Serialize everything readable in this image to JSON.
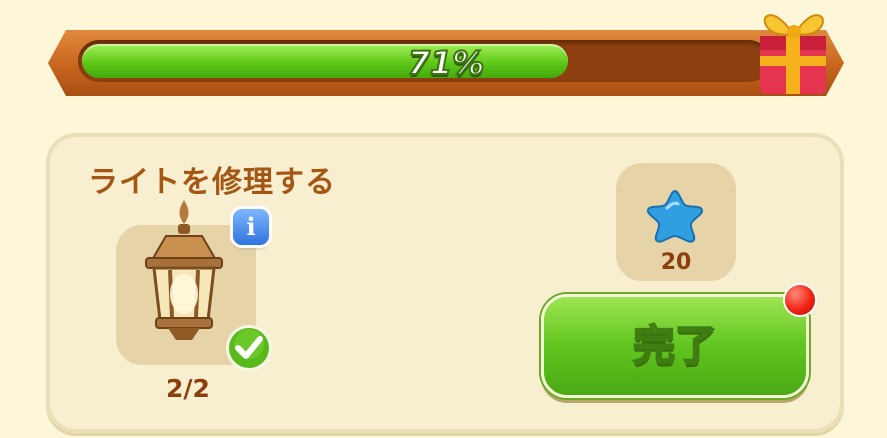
{
  "progress": {
    "label": "71%",
    "value": 0.71
  },
  "task": {
    "title": "ライトを修理する",
    "item": {
      "icon": "lantern-icon",
      "count": "2/2",
      "done": true
    },
    "reward": {
      "icon": "blue-star-icon",
      "amount": "20"
    },
    "complete_button": {
      "label": "完了",
      "has_notification": true
    }
  },
  "colors": {
    "background": "#fdf6d8",
    "progress_fill": "#5fc818",
    "title": "#a45612",
    "button": "#61c51f",
    "notification": "#f22414"
  }
}
